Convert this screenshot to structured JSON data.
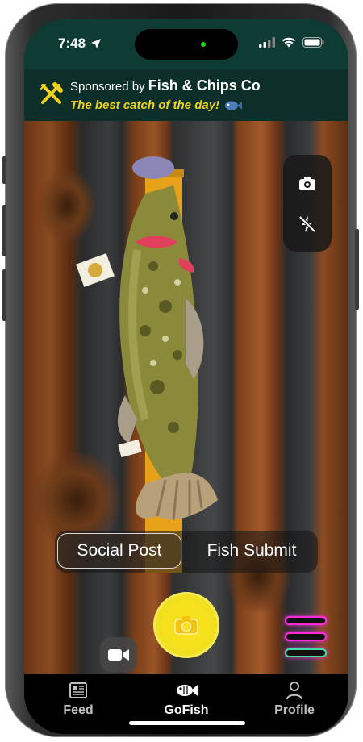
{
  "status_bar": {
    "time": "7:48"
  },
  "sponsor": {
    "prefix": "Sponsored by",
    "name": "Fish & Chips Co",
    "tagline": "The best catch of the day!"
  },
  "camera": {
    "mode_options": [
      "Social Post",
      "Fish Submit"
    ],
    "selected_mode": "Social Post"
  },
  "tabs": [
    {
      "label": "Feed",
      "icon": "newspaper-icon"
    },
    {
      "label": "GoFish",
      "icon": "fish-icon"
    },
    {
      "label": "Profile",
      "icon": "person-icon"
    }
  ],
  "active_tab": "GoFish",
  "colors": {
    "header_bg": "#0f3b35",
    "accent_yellow": "#f1d21a",
    "menu_pink": "#ff2bd6",
    "menu_green": "#3fe0a0"
  }
}
